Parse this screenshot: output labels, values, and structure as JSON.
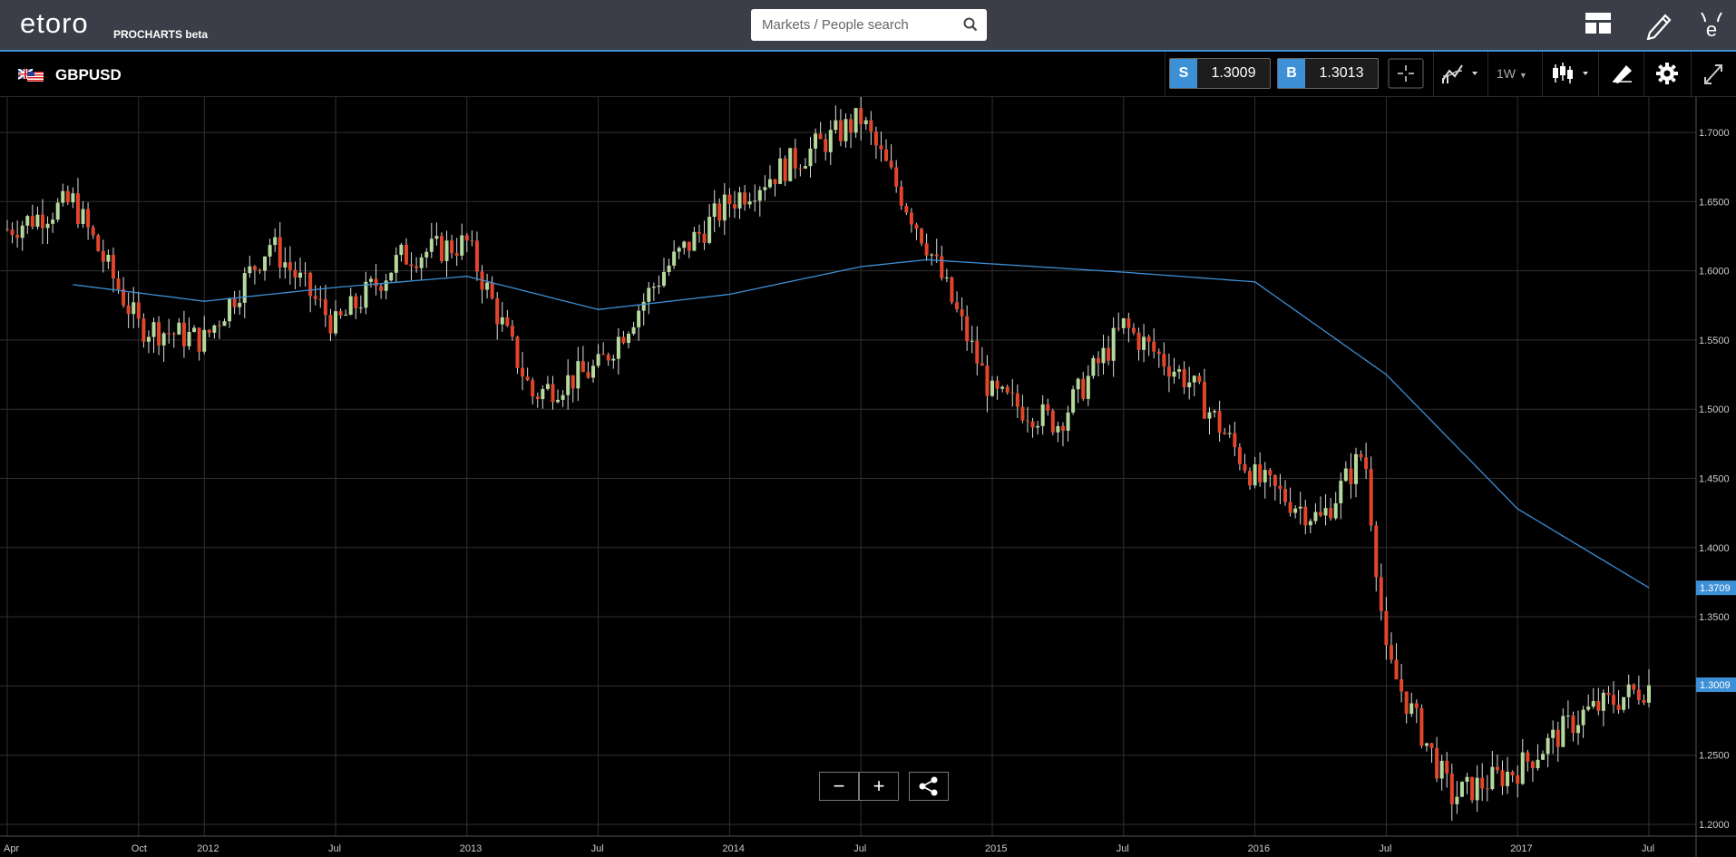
{
  "app": {
    "logo_text": "etoro",
    "logo_sub": "PROCHARTS beta",
    "search_placeholder": "Markets / People search"
  },
  "toolbar": {
    "icons": [
      "layout-icon",
      "pencil-icon",
      "etoro-icon"
    ]
  },
  "instrument": {
    "symbol": "GBPUSD",
    "sell_label": "S",
    "sell_price": "1.3009",
    "buy_label": "B",
    "buy_price": "1.3013",
    "timeframe": "1W"
  },
  "price_axis": {
    "ticks": [
      "1.7000",
      "1.6500",
      "1.6000",
      "1.5500",
      "1.5000",
      "1.4500",
      "1.4000",
      "1.3500",
      "1.3000",
      "1.2500",
      "1.2000"
    ],
    "ma_label": "1.3709",
    "last_label": "1.3009"
  },
  "time_axis": {
    "ticks": [
      "Apr",
      "Oct",
      "2012",
      "Jul",
      "2013",
      "Jul",
      "2014",
      "Jul",
      "2015",
      "Jul",
      "2016",
      "Jul",
      "2017",
      "Jul"
    ]
  },
  "controls": {
    "zoom_out": "−",
    "zoom_in": "+"
  },
  "colors": {
    "up": "#b5d99c",
    "down": "#e2452a",
    "ma": "#3d8fd6",
    "accent": "#3d8fd6",
    "background": "#000000",
    "grid": "#303030"
  },
  "chart_data": {
    "type": "candlestick",
    "ylim": [
      1.19,
      1.72
    ],
    "moving_average": {
      "name": "",
      "x": [
        "2011-07",
        "2012-01",
        "2012-07",
        "2013-01",
        "2013-07",
        "2014-01",
        "2014-07",
        "2014-10",
        "2015-01",
        "2015-07",
        "2016-01",
        "2016-07",
        "2017-01",
        "2017-07"
      ],
      "values": [
        1.59,
        1.578,
        1.588,
        1.596,
        1.572,
        1.583,
        1.603,
        1.608,
        1.605,
        1.599,
        1.592,
        1.525,
        1.428,
        1.371
      ]
    },
    "close_series": {
      "x": [
        "2011-04",
        "2011-07",
        "2011-10",
        "2012-01",
        "2012-04",
        "2012-07",
        "2012-10",
        "2013-01",
        "2013-04",
        "2013-07",
        "2013-10",
        "2014-01",
        "2014-04",
        "2014-07",
        "2014-10",
        "2015-01",
        "2015-04",
        "2015-07",
        "2015-10",
        "2016-01",
        "2016-04",
        "2016-06",
        "2016-07",
        "2016-10",
        "2017-01",
        "2017-04",
        "2017-07"
      ],
      "values": [
        1.63,
        1.65,
        1.56,
        1.55,
        1.62,
        1.56,
        1.61,
        1.62,
        1.51,
        1.53,
        1.6,
        1.65,
        1.68,
        1.71,
        1.62,
        1.51,
        1.49,
        1.56,
        1.52,
        1.45,
        1.42,
        1.47,
        1.32,
        1.22,
        1.24,
        1.28,
        1.3
      ]
    }
  }
}
